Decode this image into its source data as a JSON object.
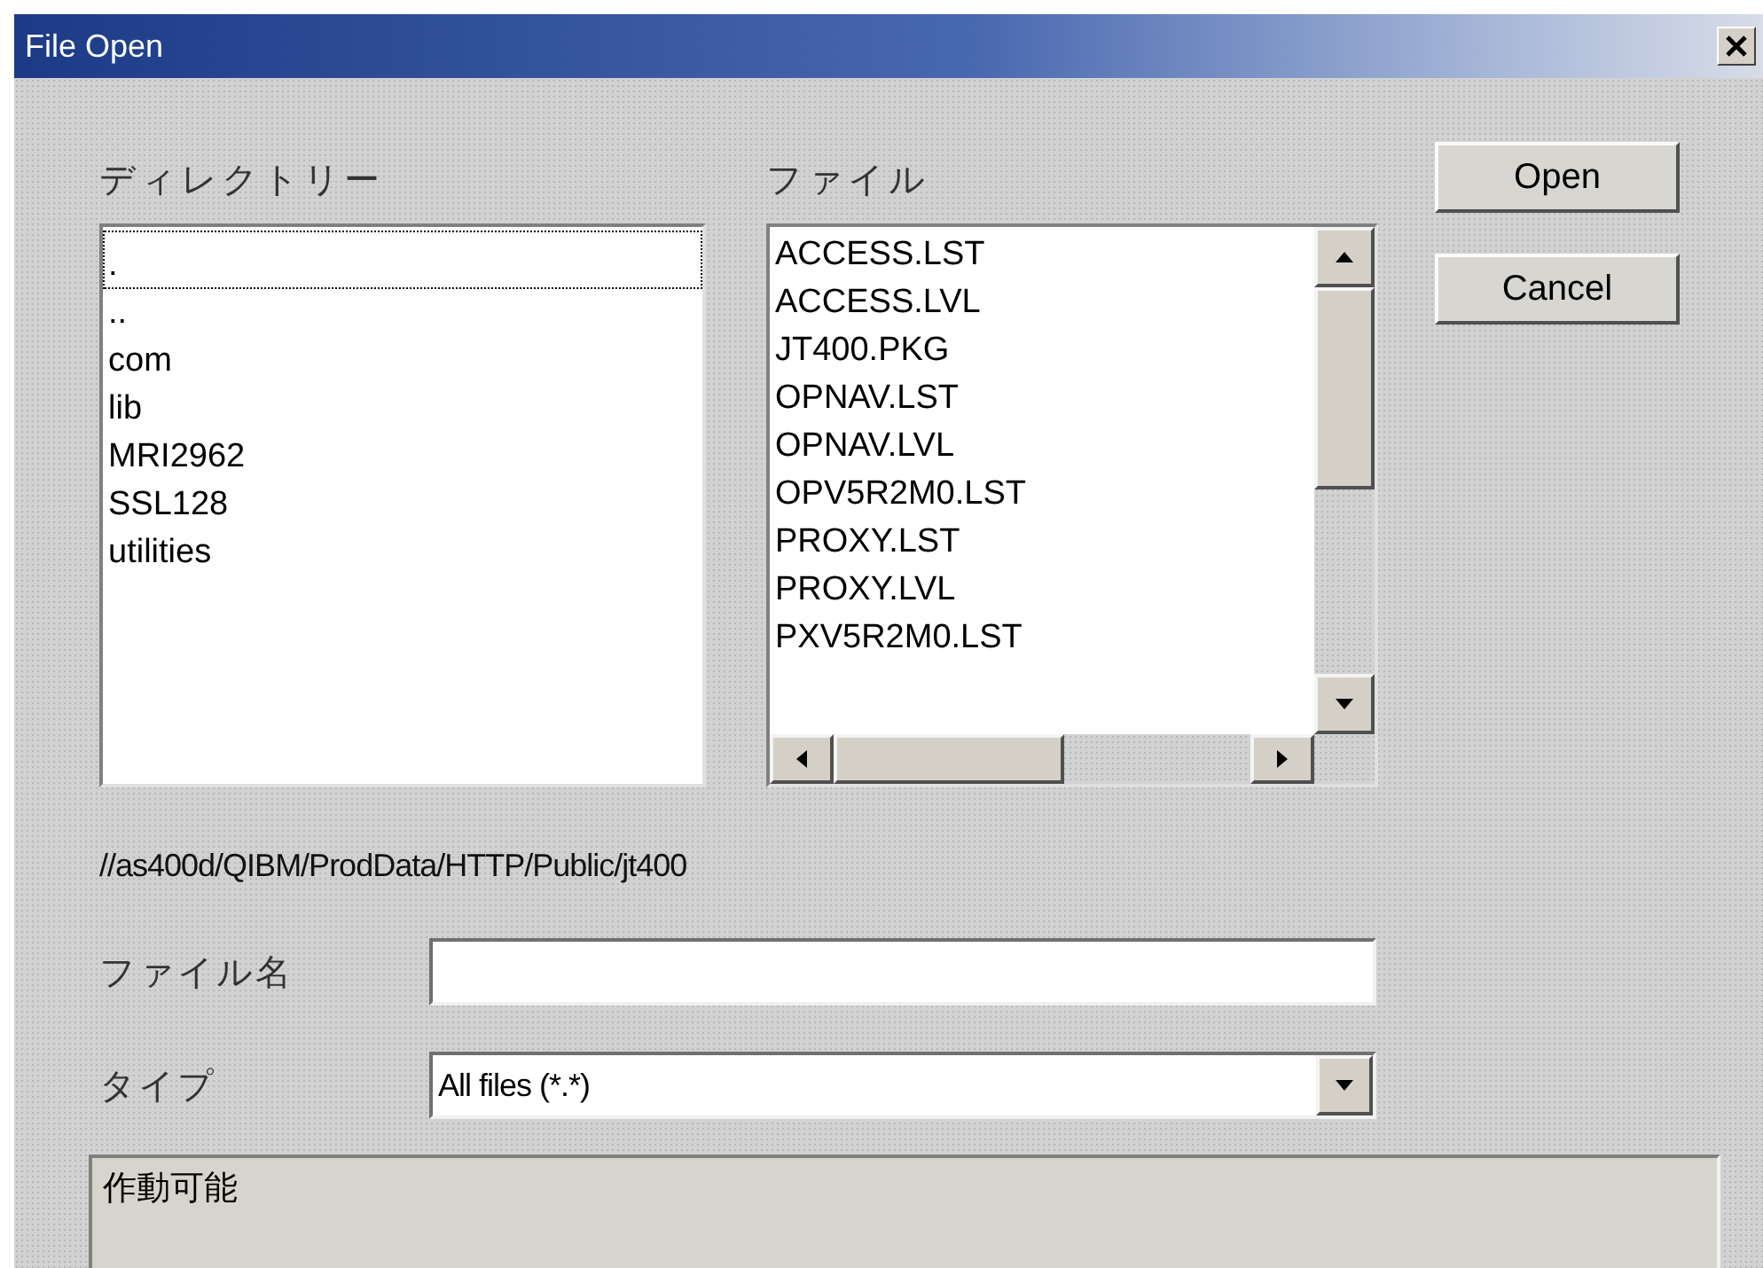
{
  "window": {
    "title": "File Open"
  },
  "directory": {
    "label": "ディレクトリー",
    "items": [
      {
        "name": ".",
        "focused": true
      },
      {
        "name": "..",
        "focused": false
      },
      {
        "name": "com",
        "focused": false
      },
      {
        "name": "lib",
        "focused": false
      },
      {
        "name": "MRI2962",
        "focused": false
      },
      {
        "name": "SSL128",
        "focused": false
      },
      {
        "name": "utilities",
        "focused": false
      }
    ]
  },
  "files": {
    "label": "ファイル",
    "items": [
      "ACCESS.LST",
      "ACCESS.LVL",
      "JT400.PKG",
      "OPNAV.LST",
      "OPNAV.LVL",
      "OPV5R2M0.LST",
      "PROXY.LST",
      "PROXY.LVL",
      "PXV5R2M0.LST"
    ]
  },
  "buttons": [
    "Open",
    "Cancel"
  ],
  "path": "//as400d/QIBM/ProdData/HTTP/Public/jt400",
  "file_name": {
    "label": "ファイル名"
  },
  "type": {
    "label": "タイプ",
    "value": "All files (*.*)"
  },
  "status_bar": "作動可能"
}
